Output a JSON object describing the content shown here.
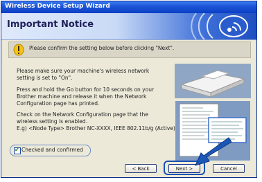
{
  "window": {
    "title": "Wireless Device Setup Wizard"
  },
  "header": {
    "title": "Important Notice"
  },
  "notice": {
    "text": "Please confirm the setting below before clicking \"Next\"."
  },
  "body": {
    "para1": "Please make sure your machine's wireless network setting is set to \"On\".",
    "para2": "Press and hold the Go button for 10 seconds on your Brother machine and release it when the Network Configuration page has printed.",
    "para3": "Check on the Network Configuration page that the wireless setting is enabled.",
    "para4": "E.g) <Node Type> Brother NC-XXXX, IEEE 802.11b/g (Active)"
  },
  "checkbox": {
    "label": "Checked and confirmed",
    "checked": true
  },
  "buttons": {
    "back": "< Back",
    "next": "Next >",
    "cancel": "Cancel"
  },
  "colors": {
    "titlebar": "#1e56d6",
    "highlight": "#1a4fb3",
    "arrow": "#1c58b8"
  },
  "icons": {
    "notice": "warning-icon",
    "logo": "wireless-logo-icon"
  }
}
